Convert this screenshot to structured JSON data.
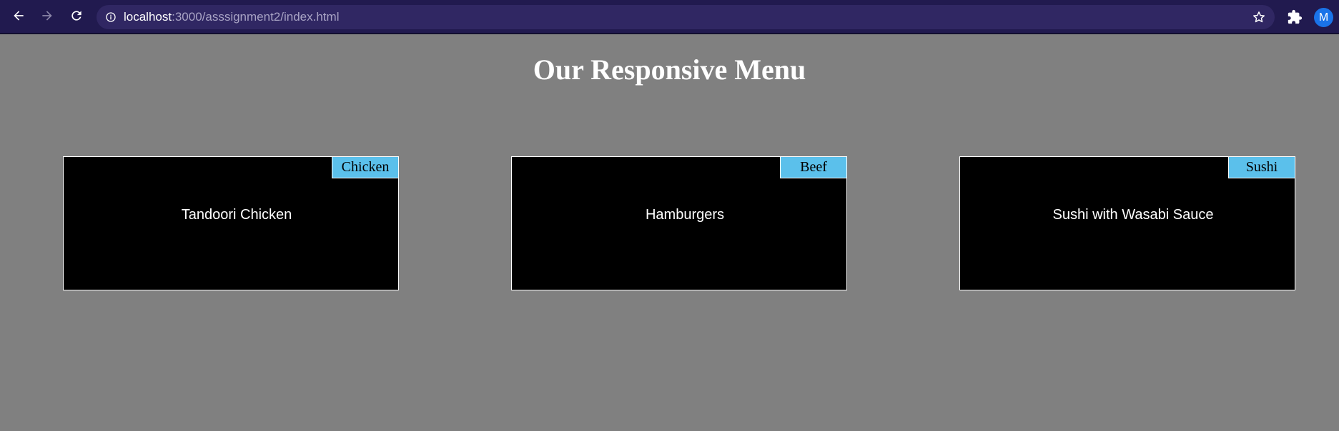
{
  "browser": {
    "url_host": "localhost",
    "url_rest": ":3000/asssignment2/index.html",
    "profile_initial": "M"
  },
  "page": {
    "title": "Our Responsive Menu",
    "cards": [
      {
        "tag": "Chicken",
        "text": "Tandoori Chicken"
      },
      {
        "tag": "Beef",
        "text": "Hamburgers"
      },
      {
        "tag": "Sushi",
        "text": "Sushi with Wasabi Sauce"
      }
    ]
  },
  "colors": {
    "page_background": "#808080",
    "browser_bar": "#211a4f",
    "omnibox": "#302763",
    "card_background": "#000000",
    "tag_background": "#5bc0eb",
    "avatar": "#1a73e8"
  },
  "icons": {
    "back": "arrow-left-icon",
    "forward": "arrow-right-icon",
    "reload": "reload-icon",
    "info": "info-icon",
    "bookmark": "star-icon",
    "extensions": "puzzle-icon"
  }
}
